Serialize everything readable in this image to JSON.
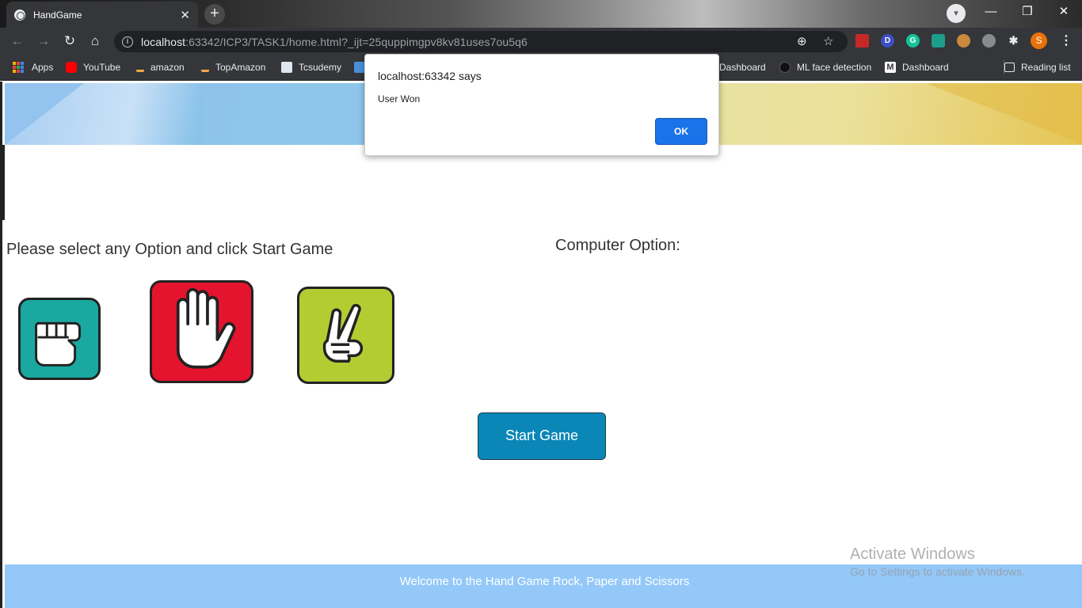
{
  "browser": {
    "tab_title": "HandGame",
    "tab_close": "✕",
    "new_tab": "+",
    "url_host": "localhost",
    "url_rest": ":63342/ICP3/TASK1/home.html?_ijt=25quppimgpv8kv81uses7ou5q6",
    "profile_initial": "S",
    "window_controls": {
      "minimize": "—",
      "restore": "❐",
      "close": "✕"
    }
  },
  "bookmarks": [
    {
      "label": "Apps",
      "icon": "apps-grid-icon"
    },
    {
      "label": "YouTube",
      "icon": "youtube-icon",
      "color": "#ff0000"
    },
    {
      "label": "amazon",
      "icon": "amazon-icon",
      "color": "#f3a847"
    },
    {
      "label": "TopAmazon",
      "icon": "amazon-icon",
      "color": "#f3a847"
    },
    {
      "label": "Tcsudemy",
      "icon": "tata-icon",
      "color": "#6b8fb8"
    },
    {
      "label": "Dashboard",
      "icon": "dashboard-icon",
      "color": "#444"
    },
    {
      "label": "ML face detection",
      "icon": "github-icon",
      "color": "#111"
    },
    {
      "label": "Dashboard",
      "icon": "m-logo-icon",
      "color": "#ffffff"
    },
    {
      "label": "Reading list",
      "icon": "reading-list-icon"
    }
  ],
  "page": {
    "instruction": "Please select any Option and click Start Game",
    "computer_label": "Computer Option:",
    "choices": [
      {
        "name": "rock",
        "color": "#1aa9a0"
      },
      {
        "name": "paper",
        "color": "#e4142e"
      },
      {
        "name": "scissors",
        "color": "#b2cc32"
      }
    ],
    "start_button": "Start Game",
    "footer": "Welcome to the Hand Game Rock, Paper and Scissors"
  },
  "dialog": {
    "origin": "localhost:63342 says",
    "message": "User Won",
    "ok_label": "OK"
  },
  "watermark": {
    "title": "Activate Windows",
    "subtitle": "Go to Settings to activate Windows."
  },
  "colors": {
    "accent_button": "#0a87b7",
    "footer_bg": "#94c8f9",
    "dialog_ok": "#1a73e8"
  }
}
